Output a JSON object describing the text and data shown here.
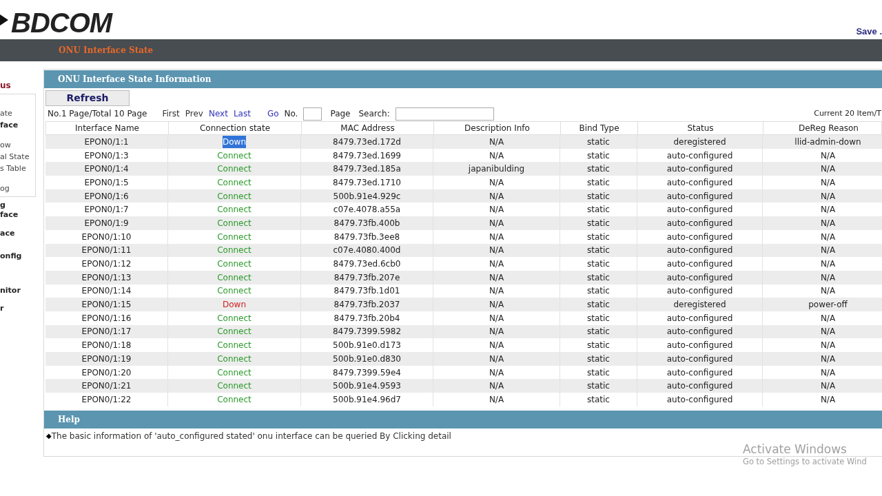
{
  "header": {
    "logo": "BDCOM",
    "save_link": "Save ."
  },
  "nav_bar": {
    "title": "ONU Interface State"
  },
  "sidebar": {
    "heading": "us",
    "box_items": [
      {
        "label": "ate",
        "bold": false
      },
      {
        "label": "face",
        "bold": true
      },
      {
        "label": "ow",
        "bold": false
      },
      {
        "label": "al State",
        "bold": false
      },
      {
        "label": "s Table",
        "bold": false
      },
      {
        "label": "og",
        "bold": false
      }
    ],
    "items": [
      "g",
      "face",
      "ace",
      "onfig",
      "nitor",
      "r"
    ]
  },
  "panel": {
    "title": "ONU Interface State Information",
    "refresh_button": "Refresh",
    "pager": {
      "info": "No.1 Page/Total 10 Page",
      "links": [
        {
          "label": "First",
          "enabled": false
        },
        {
          "label": "Prev",
          "enabled": false
        },
        {
          "label": "Next",
          "enabled": true
        },
        {
          "label": "Last",
          "enabled": true
        }
      ],
      "go": "Go",
      "no_label": "No.",
      "page_label": "Page",
      "search_label": "Search:",
      "current": "Current 20 Item/T"
    },
    "table": {
      "columns": [
        "Interface Name",
        "Connection state",
        "MAC Address",
        "Description Info",
        "Bind Type",
        "Status",
        "DeReg Reason"
      ],
      "rows": [
        {
          "name": "EPON0/1:1",
          "state": "Down",
          "connected": false,
          "text_selected": true,
          "mac": "8479.73ed.172d",
          "desc": "N/A",
          "bind": "static",
          "status": "deregistered",
          "reason": "llid-admin-down"
        },
        {
          "name": "EPON0/1:3",
          "state": "Connect",
          "connected": true,
          "text_selected": false,
          "mac": "8479.73ed.1699",
          "desc": "N/A",
          "bind": "static",
          "status": "auto-configured",
          "reason": "N/A"
        },
        {
          "name": "EPON0/1:4",
          "state": "Connect",
          "connected": true,
          "text_selected": false,
          "mac": "8479.73ed.185a",
          "desc": "japanibulding",
          "bind": "static",
          "status": "auto-configured",
          "reason": "N/A"
        },
        {
          "name": "EPON0/1:5",
          "state": "Connect",
          "connected": true,
          "text_selected": false,
          "mac": "8479.73ed.1710",
          "desc": "N/A",
          "bind": "static",
          "status": "auto-configured",
          "reason": "N/A"
        },
        {
          "name": "EPON0/1:6",
          "state": "Connect",
          "connected": true,
          "text_selected": false,
          "mac": "500b.91e4.929c",
          "desc": "N/A",
          "bind": "static",
          "status": "auto-configured",
          "reason": "N/A"
        },
        {
          "name": "EPON0/1:7",
          "state": "Connect",
          "connected": true,
          "text_selected": false,
          "mac": "c07e.4078.a55a",
          "desc": "N/A",
          "bind": "static",
          "status": "auto-configured",
          "reason": "N/A"
        },
        {
          "name": "EPON0/1:9",
          "state": "Connect",
          "connected": true,
          "text_selected": false,
          "mac": "8479.73fb.400b",
          "desc": "N/A",
          "bind": "static",
          "status": "auto-configured",
          "reason": "N/A"
        },
        {
          "name": "EPON0/1:10",
          "state": "Connect",
          "connected": true,
          "text_selected": false,
          "mac": "8479.73fb.3ee8",
          "desc": "N/A",
          "bind": "static",
          "status": "auto-configured",
          "reason": "N/A"
        },
        {
          "name": "EPON0/1:11",
          "state": "Connect",
          "connected": true,
          "text_selected": false,
          "mac": "c07e.4080.400d",
          "desc": "N/A",
          "bind": "static",
          "status": "auto-configured",
          "reason": "N/A"
        },
        {
          "name": "EPON0/1:12",
          "state": "Connect",
          "connected": true,
          "text_selected": false,
          "mac": "8479.73ed.6cb0",
          "desc": "N/A",
          "bind": "static",
          "status": "auto-configured",
          "reason": "N/A"
        },
        {
          "name": "EPON0/1:13",
          "state": "Connect",
          "connected": true,
          "text_selected": false,
          "mac": "8479.73fb.207e",
          "desc": "N/A",
          "bind": "static",
          "status": "auto-configured",
          "reason": "N/A"
        },
        {
          "name": "EPON0/1:14",
          "state": "Connect",
          "connected": true,
          "text_selected": false,
          "mac": "8479.73fb.1d01",
          "desc": "N/A",
          "bind": "static",
          "status": "auto-configured",
          "reason": "N/A"
        },
        {
          "name": "EPON0/1:15",
          "state": "Down",
          "connected": false,
          "text_selected": false,
          "mac": "8479.73fb.2037",
          "desc": "N/A",
          "bind": "static",
          "status": "deregistered",
          "reason": "power-off"
        },
        {
          "name": "EPON0/1:16",
          "state": "Connect",
          "connected": true,
          "text_selected": false,
          "mac": "8479.73fb.20b4",
          "desc": "N/A",
          "bind": "static",
          "status": "auto-configured",
          "reason": "N/A"
        },
        {
          "name": "EPON0/1:17",
          "state": "Connect",
          "connected": true,
          "text_selected": false,
          "mac": "8479.7399.5982",
          "desc": "N/A",
          "bind": "static",
          "status": "auto-configured",
          "reason": "N/A"
        },
        {
          "name": "EPON0/1:18",
          "state": "Connect",
          "connected": true,
          "text_selected": false,
          "mac": "500b.91e0.d173",
          "desc": "N/A",
          "bind": "static",
          "status": "auto-configured",
          "reason": "N/A"
        },
        {
          "name": "EPON0/1:19",
          "state": "Connect",
          "connected": true,
          "text_selected": false,
          "mac": "500b.91e0.d830",
          "desc": "N/A",
          "bind": "static",
          "status": "auto-configured",
          "reason": "N/A"
        },
        {
          "name": "EPON0/1:20",
          "state": "Connect",
          "connected": true,
          "text_selected": false,
          "mac": "8479.7399.59e4",
          "desc": "N/A",
          "bind": "static",
          "status": "auto-configured",
          "reason": "N/A"
        },
        {
          "name": "EPON0/1:21",
          "state": "Connect",
          "connected": true,
          "text_selected": false,
          "mac": "500b.91e4.9593",
          "desc": "N/A",
          "bind": "static",
          "status": "auto-configured",
          "reason": "N/A"
        },
        {
          "name": "EPON0/1:22",
          "state": "Connect",
          "connected": true,
          "text_selected": false,
          "mac": "500b.91e4.96d7",
          "desc": "N/A",
          "bind": "static",
          "status": "auto-configured",
          "reason": "N/A"
        }
      ]
    }
  },
  "help": {
    "title": "Help",
    "bullet": "◆",
    "text": "The basic information of 'auto_configured stated' onu interface can be queried By Clicking detail"
  },
  "activation_notice": {
    "title": "Activate Windows",
    "subtitle": "Go to Settings to activate Wind"
  }
}
